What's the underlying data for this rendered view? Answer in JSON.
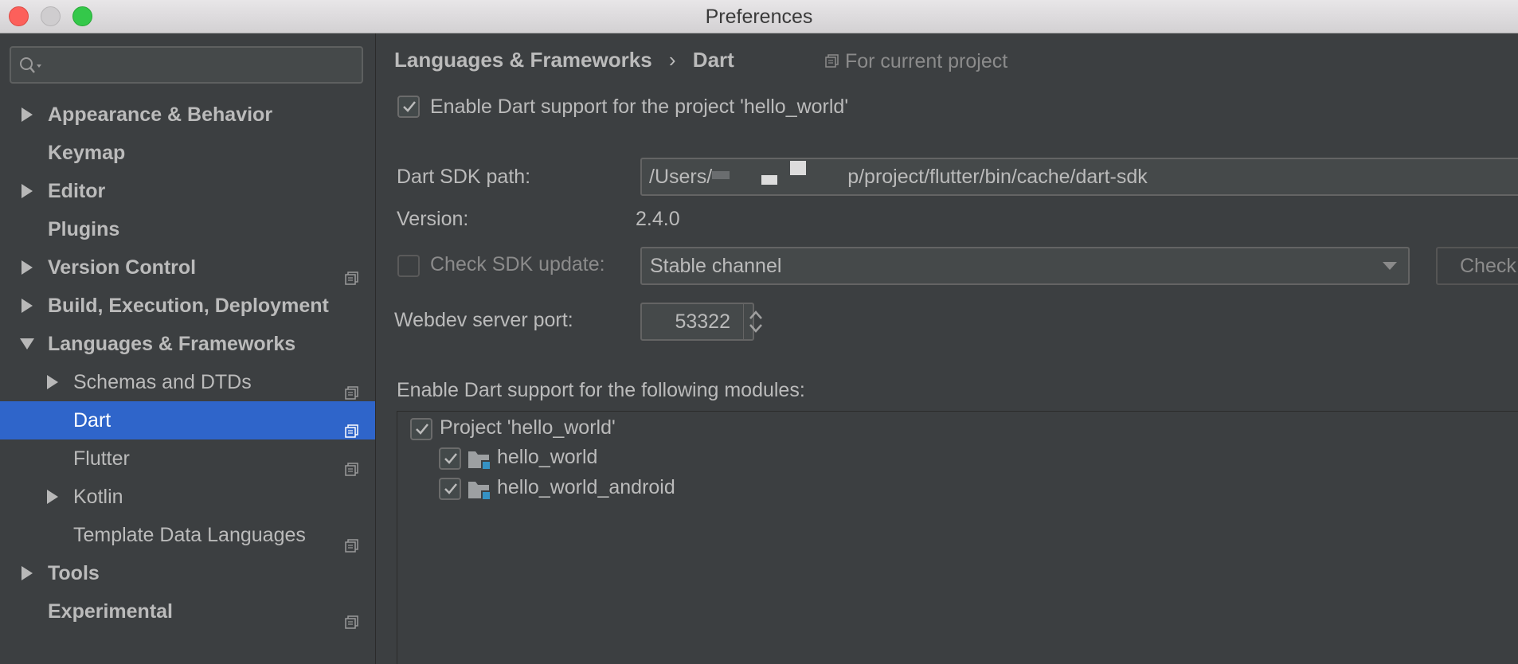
{
  "window": {
    "title": "Preferences"
  },
  "sidebar": {
    "search": {
      "value": "",
      "placeholder": ""
    },
    "items": [
      {
        "label": "Appearance & Behavior",
        "bold": true,
        "arrow": "right",
        "project_icon": false
      },
      {
        "label": "Keymap",
        "bold": true,
        "arrow": "none",
        "project_icon": false
      },
      {
        "label": "Editor",
        "bold": true,
        "arrow": "right",
        "project_icon": false
      },
      {
        "label": "Plugins",
        "bold": true,
        "arrow": "none",
        "project_icon": false
      },
      {
        "label": "Version Control",
        "bold": true,
        "arrow": "right",
        "project_icon": true
      },
      {
        "label": "Build, Execution, Deployment",
        "bold": true,
        "arrow": "right",
        "project_icon": false
      },
      {
        "label": "Languages & Frameworks",
        "bold": true,
        "arrow": "down",
        "project_icon": false
      },
      {
        "label": "Schemas and DTDs",
        "bold": false,
        "arrow": "right",
        "project_icon": true
      },
      {
        "label": "Dart",
        "bold": false,
        "arrow": "none",
        "project_icon": true,
        "selected": true
      },
      {
        "label": "Flutter",
        "bold": false,
        "arrow": "none",
        "project_icon": true
      },
      {
        "label": "Kotlin",
        "bold": false,
        "arrow": "right",
        "project_icon": false
      },
      {
        "label": "Template Data Languages",
        "bold": false,
        "arrow": "none",
        "project_icon": true
      },
      {
        "label": "Tools",
        "bold": true,
        "arrow": "right",
        "project_icon": false
      },
      {
        "label": "Experimental",
        "bold": true,
        "arrow": "none",
        "project_icon": true
      }
    ]
  },
  "content": {
    "breadcrumb": {
      "parent": "Languages & Frameworks",
      "separator": "›",
      "current": "Dart",
      "scope": "For current project"
    },
    "enable_dart": {
      "label": "Enable Dart support for the project 'hello_world'",
      "checked": true
    },
    "sdk_path": {
      "label": "Dart SDK path:",
      "value": "/Users/",
      "value_suffix": "p/project/flutter/bin/cache/dart-sdk"
    },
    "version": {
      "label": "Version:",
      "value": "2.4.0"
    },
    "check_sdk": {
      "label": "Check SDK update:",
      "checked": false,
      "channel": "Stable channel",
      "check_button": "Check"
    },
    "webdev_port": {
      "label": "Webdev server port:",
      "value": "53322"
    },
    "modules": {
      "label": "Enable Dart support for the following modules:",
      "project": {
        "label": "Project 'hello_world'",
        "checked": true
      },
      "items": [
        {
          "label": "hello_world",
          "checked": true
        },
        {
          "label": "hello_world_android",
          "checked": true
        }
      ]
    }
  },
  "colors": {
    "background": "#3c3f41",
    "selection": "#2f65ca",
    "text": "#bbbbbb",
    "module_icon_accent": "#3592c4"
  }
}
